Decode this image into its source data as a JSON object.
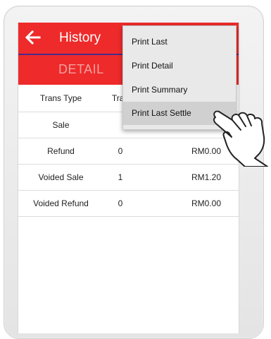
{
  "appbar": {
    "title": "History",
    "back_icon": "arrow-left-icon"
  },
  "tabs": {
    "active_label": "DETAIL"
  },
  "table": {
    "headers": [
      "Trans Type",
      "Tran"
    ],
    "rows": [
      {
        "type": "Sale",
        "count": "",
        "amount": ""
      },
      {
        "type": "Refund",
        "count": "0",
        "amount": "RM0.00"
      },
      {
        "type": "Voided Sale",
        "count": "1",
        "amount": "RM1.20"
      },
      {
        "type": "Voided Refund",
        "count": "0",
        "amount": "RM0.00"
      }
    ]
  },
  "menu": {
    "items": [
      {
        "label": "Print Last"
      },
      {
        "label": "Print Detail"
      },
      {
        "label": "Print Summary"
      },
      {
        "label": "Print Last Settle"
      }
    ],
    "highlighted_index": 3
  },
  "colors": {
    "accent": "#ee2a2a",
    "divider": "#4a2b8c",
    "menu_bg": "#e9e9e9"
  }
}
